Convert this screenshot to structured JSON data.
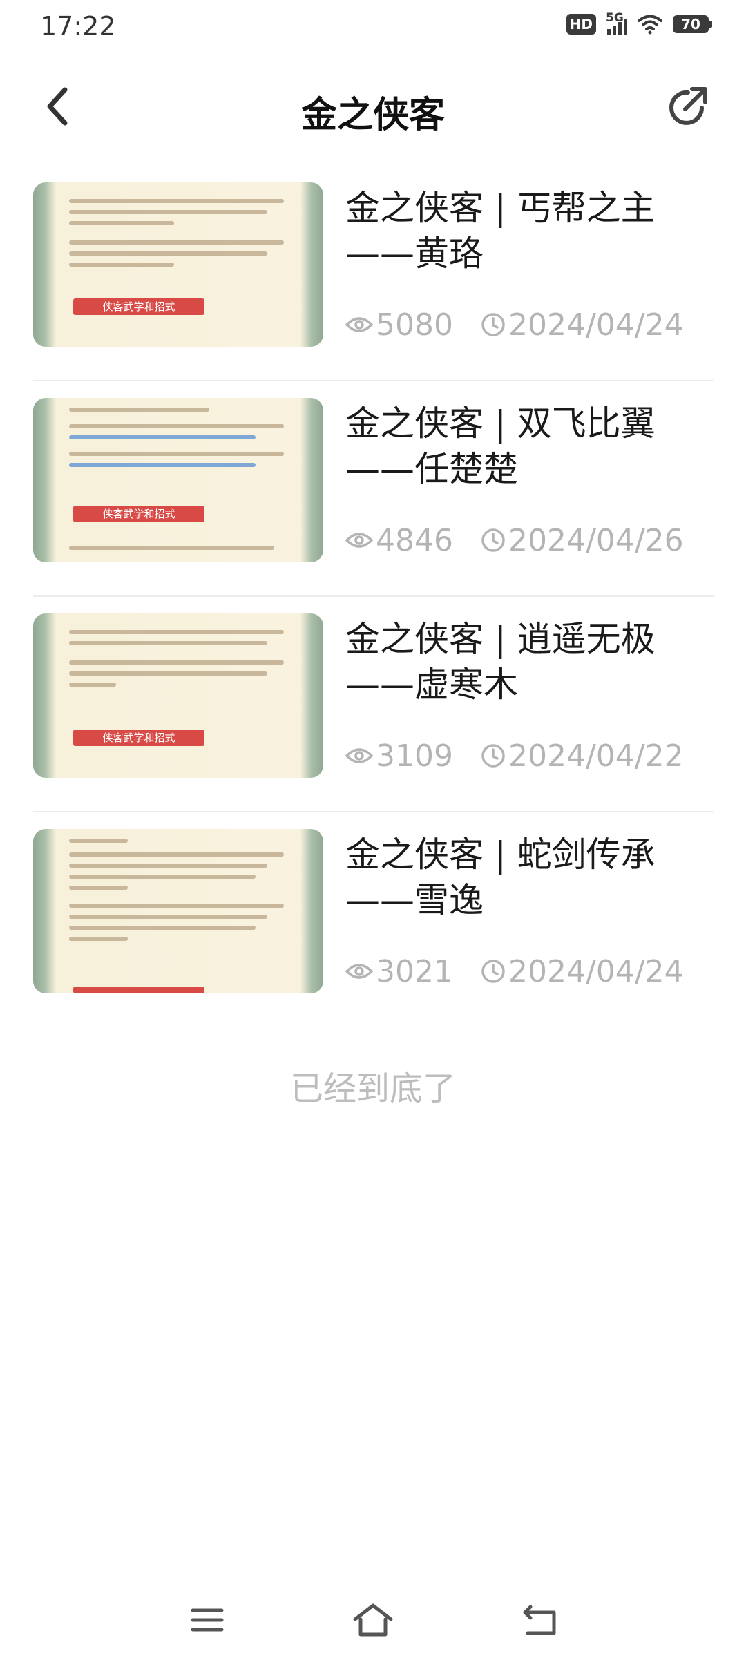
{
  "status_bar": {
    "time": "17:22",
    "hd": "HD",
    "network": "5G",
    "battery": "70"
  },
  "header": {
    "title": "金之侠客"
  },
  "items": [
    {
      "title": "金之侠客 | 丐帮之主\n——黄珞",
      "views": "5080",
      "date": "2024/04/24",
      "thumb_banner": "侠客武学和招式"
    },
    {
      "title": "金之侠客 | 双飞比翼\n——任楚楚",
      "views": "4846",
      "date": "2024/04/26",
      "thumb_banner": "侠客武学和招式"
    },
    {
      "title": "金之侠客 | 逍遥无极\n——虚寒木",
      "views": "3109",
      "date": "2024/04/22",
      "thumb_banner": "侠客武学和招式"
    },
    {
      "title": "金之侠客 | 蛇剑传承\n——雪逸",
      "views": "3021",
      "date": "2024/04/24",
      "thumb_banner": ""
    }
  ],
  "footer": {
    "end_text": "已经到底了"
  },
  "icons": {
    "back": "back-arrow-icon",
    "share": "share-icon",
    "eye": "eye-icon",
    "clock": "clock-icon",
    "menu": "menu-icon",
    "home": "home-icon",
    "return": "return-icon"
  },
  "colors": {
    "meta_text": "#b4b4b4",
    "banner": "#d74a45",
    "thumb_border": "#8fa891"
  }
}
